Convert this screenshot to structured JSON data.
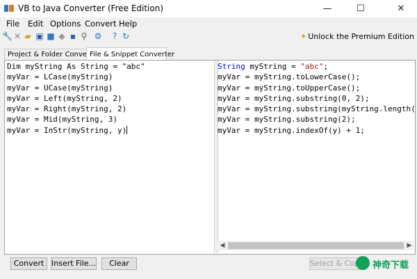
{
  "window": {
    "title": "VB to Java Converter (Free Edition)",
    "minimize_glyph": "—",
    "maximize_glyph": "☐",
    "close_glyph": "✕"
  },
  "menu": [
    "File",
    "Edit",
    "Options",
    "Convert",
    "Help"
  ],
  "toolbar": {
    "icons": [
      "wrench-icon",
      "delete-icon",
      "open-folder-icon",
      "window-icon",
      "copy-icon",
      "eraser-icon",
      "save-icon",
      "find-icon",
      "settings-icon",
      "help-icon",
      "refresh-icon"
    ],
    "unlock_label": "Unlock the Premium Edition"
  },
  "tabs": [
    {
      "label": "Project & Folder Converter",
      "active": false
    },
    {
      "label": "File & Snippet Converter",
      "active": true
    }
  ],
  "source_code": [
    "Dim myString As String = \"abc\"",
    "myVar = LCase(myString)",
    "myVar = UCase(myString)",
    "myVar = Left(myString, 2)",
    "myVar = Right(myString, 2)",
    "myVar = Mid(myString, 3)",
    "myVar = InStr(myString, y)"
  ],
  "converted_code": [
    "String myString = \"abc\";",
    "myVar = myString.toLowerCase();",
    "myVar = myString.toUpperCase();",
    "myVar = myString.substring(0, 2);",
    "myVar = myString.substring(myString.length()",
    "myVar = myString.substring(2);",
    "myVar = myString.indexOf(y) + 1;"
  ],
  "buttons": {
    "convert": "Convert",
    "insert_file": "Insert File...",
    "clear": "Clear",
    "select_copy": "Select & Copy"
  },
  "watermark": "神奇下载",
  "colors": {
    "keyword": "#0000ff",
    "string": "#a31515",
    "watermark": "#13a05a"
  }
}
